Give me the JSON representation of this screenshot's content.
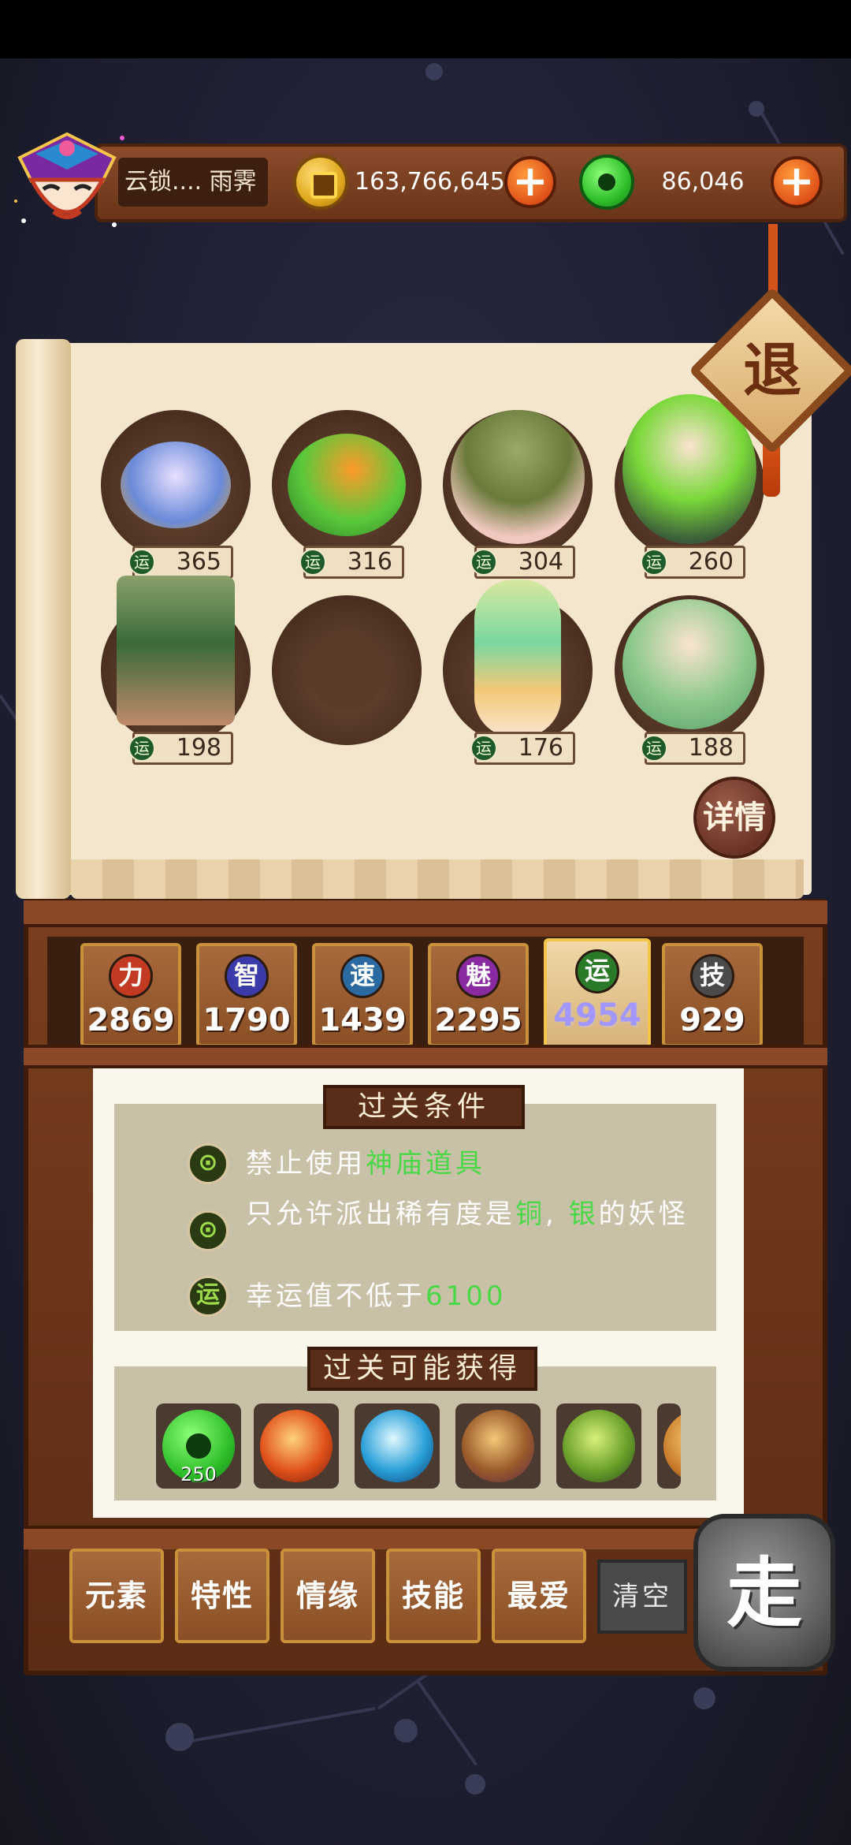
{
  "player": {
    "name": "云锁.... 雨霁"
  },
  "currency": {
    "gold": "163,766,645",
    "jade": "86,046"
  },
  "exit_label": "退",
  "detail_label": "详情",
  "roster": [
    {
      "luck_icon": "运",
      "luck": "365"
    },
    {
      "luck_icon": "运",
      "luck": "316"
    },
    {
      "luck_icon": "运",
      "luck": "304"
    },
    {
      "luck_icon": "运",
      "luck": "260"
    },
    {
      "luck_icon": "运",
      "luck": "198"
    },
    {
      "luck_icon": "",
      "luck": ""
    },
    {
      "luck_icon": "运",
      "luck": "176"
    },
    {
      "luck_icon": "运",
      "luck": "188"
    }
  ],
  "stats": [
    {
      "icon": "力",
      "value": "2869",
      "color": "#c23a22"
    },
    {
      "icon": "智",
      "value": "1790",
      "color": "#3a3aa8"
    },
    {
      "icon": "速",
      "value": "1439",
      "color": "#2a6aa0"
    },
    {
      "icon": "魅",
      "value": "2295",
      "color": "#8a2aa0"
    },
    {
      "icon": "运",
      "value": "4954",
      "color": "#2a7a2a"
    },
    {
      "icon": "技",
      "value": "929",
      "color": "#4a4a4a"
    }
  ],
  "conditions": {
    "title": "过关条件",
    "items": [
      {
        "icon": "⊙",
        "pre": "禁止使用",
        "hl": "神庙道具",
        "mid": "",
        "hl2": "",
        "post": ""
      },
      {
        "icon": "⊙",
        "pre": "只允许派出稀有度是",
        "hl": "铜",
        "mid": ", ",
        "hl2": "银",
        "post": "的妖怪"
      },
      {
        "icon": "运",
        "pre": "幸运值不低于",
        "hl": "6100",
        "mid": "",
        "hl2": "",
        "post": ""
      }
    ]
  },
  "rewards": {
    "title": "过关可能获得",
    "items": [
      {
        "icon": "jade-coin-icon",
        "count": "250",
        "color": "#2fbf2a"
      },
      {
        "icon": "fire-orb-icon",
        "count": "",
        "color": "#e0521a"
      },
      {
        "icon": "water-orb-icon",
        "count": "",
        "color": "#2aa0d8"
      },
      {
        "icon": "earth-orb-icon",
        "count": "",
        "color": "#9a5a2a"
      },
      {
        "icon": "wood-orb-icon",
        "count": "",
        "color": "#6aa02a"
      }
    ]
  },
  "filters": [
    "元素",
    "特性",
    "情缘",
    "技能",
    "最爱"
  ],
  "clear_label": "清空",
  "go_label": "走"
}
